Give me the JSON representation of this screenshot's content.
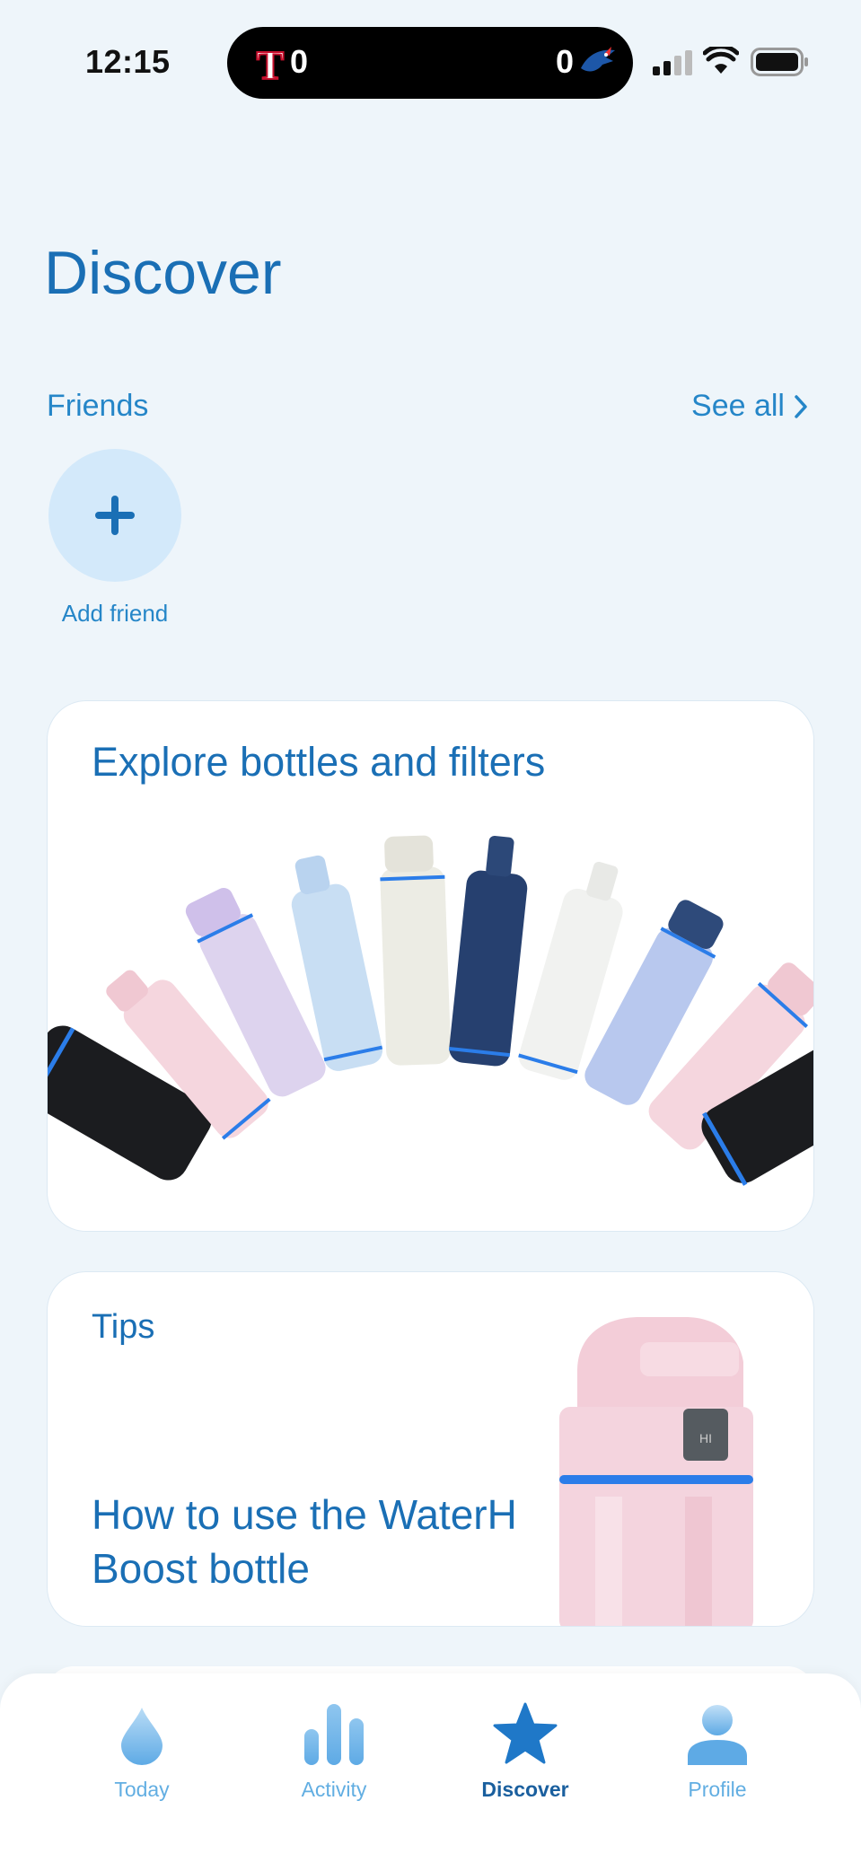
{
  "status_bar": {
    "time": "12:15",
    "score_left": "0",
    "score_right": "0",
    "team_left_icon": "rangers-logo-icon",
    "team_right_icon": "blue-jays-logo-icon"
  },
  "page": {
    "title": "Discover"
  },
  "friends": {
    "label": "Friends",
    "see_all": "See all",
    "add_friend_label": "Add friend"
  },
  "explore_card": {
    "title": "Explore bottles and filters"
  },
  "tips_card": {
    "label": "Tips",
    "headline": "How to use the WaterH Boost bottle"
  },
  "tab_bar": {
    "tabs": [
      {
        "label": "Today",
        "icon": "droplet-icon",
        "active": false
      },
      {
        "label": "Activity",
        "icon": "bar-chart-icon",
        "active": false
      },
      {
        "label": "Discover",
        "icon": "star-icon",
        "active": true
      },
      {
        "label": "Profile",
        "icon": "person-icon",
        "active": false
      }
    ]
  },
  "colors": {
    "background": "#eef5fa",
    "primary": "#1a6fb5",
    "accent": "#2586c8",
    "tab_inactive": "#62aee2",
    "tab_active": "#1a5f9e",
    "bottle_ring": "#2b7de9"
  }
}
